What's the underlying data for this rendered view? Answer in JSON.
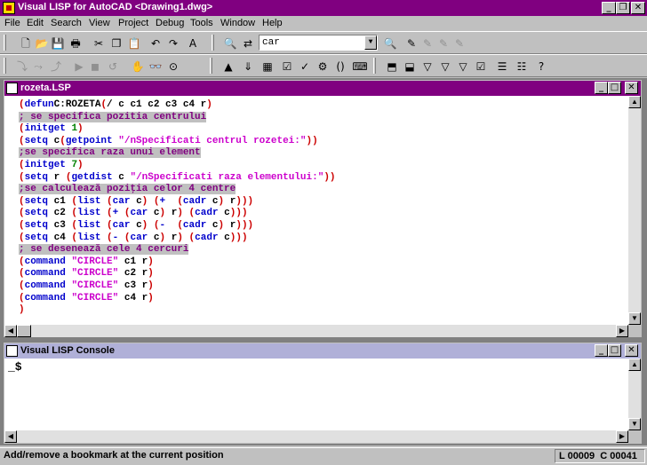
{
  "app": {
    "title": "Visual LISP for AutoCAD <Drawing1.dwg>"
  },
  "menu": [
    "File",
    "Edit",
    "Search",
    "View",
    "Project",
    "Debug",
    "Tools",
    "Window",
    "Help"
  ],
  "search": {
    "value": "car"
  },
  "editor": {
    "title": "rozeta.LSP",
    "lines": [
      [
        [
          "par",
          "("
        ],
        [
          "kw",
          "defun"
        ],
        [
          "",
          "C:ROZETA"
        ],
        [
          "par",
          "("
        ],
        [
          "",
          "/ c c1 c2 c3 c4 r"
        ],
        [
          "par",
          ")"
        ]
      ],
      [
        [
          "cmt",
          "; se specifica pozitia centrului"
        ]
      ],
      [
        [
          "par",
          "("
        ],
        [
          "kw",
          "initget"
        ],
        [
          "",
          " "
        ],
        [
          "num",
          "1"
        ],
        [
          "par",
          ")"
        ]
      ],
      [
        [
          "par",
          "("
        ],
        [
          "kw",
          "setq"
        ],
        [
          "",
          " c"
        ],
        [
          "par",
          "("
        ],
        [
          "kw",
          "getpoint"
        ],
        [
          "",
          " "
        ],
        [
          "str",
          "\"/nSpecificati centrul rozetei:\""
        ],
        [
          "par",
          "))"
        ]
      ],
      [
        [
          "cmt",
          ";se specifica raza unui element"
        ]
      ],
      [
        [
          "par",
          "("
        ],
        [
          "kw",
          "initget"
        ],
        [
          "",
          " "
        ],
        [
          "num",
          "7"
        ],
        [
          "par",
          ")"
        ]
      ],
      [
        [
          "par",
          "("
        ],
        [
          "kw",
          "setq"
        ],
        [
          "",
          " r "
        ],
        [
          "par",
          "("
        ],
        [
          "kw",
          "getdist"
        ],
        [
          "",
          " c "
        ],
        [
          "str",
          "\"/nSpecificati raza elementului:\""
        ],
        [
          "par",
          "))"
        ]
      ],
      [
        [
          "cmt",
          ";se calculează poziţia celor 4 centre"
        ]
      ],
      [
        [
          "par",
          "("
        ],
        [
          "kw",
          "setq"
        ],
        [
          "",
          " c1 "
        ],
        [
          "par",
          "("
        ],
        [
          "kw",
          "list"
        ],
        [
          "",
          " "
        ],
        [
          "par",
          "("
        ],
        [
          "kw",
          "car"
        ],
        [
          "",
          " c"
        ],
        [
          "par",
          ")"
        ],
        [
          "",
          " "
        ],
        [
          "par",
          "("
        ],
        [
          "kw",
          "+"
        ],
        [
          "",
          "  "
        ],
        [
          "par",
          "("
        ],
        [
          "kw",
          "cadr"
        ],
        [
          "",
          " c"
        ],
        [
          "par",
          ")"
        ],
        [
          "",
          " r"
        ],
        [
          "par",
          ")))"
        ]
      ],
      [
        [
          "par",
          "("
        ],
        [
          "kw",
          "setq"
        ],
        [
          "",
          " c2 "
        ],
        [
          "par",
          "("
        ],
        [
          "kw",
          "list"
        ],
        [
          "",
          " "
        ],
        [
          "par",
          "("
        ],
        [
          "kw",
          "+"
        ],
        [
          "",
          " "
        ],
        [
          "par",
          "("
        ],
        [
          "kw",
          "car"
        ],
        [
          "",
          " c"
        ],
        [
          "par",
          ")"
        ],
        [
          "",
          " r"
        ],
        [
          "par",
          ")"
        ],
        [
          "",
          " "
        ],
        [
          "par",
          "("
        ],
        [
          "kw",
          "cadr"
        ],
        [
          "",
          " c"
        ],
        [
          "par",
          ")))"
        ]
      ],
      [
        [
          "par",
          "("
        ],
        [
          "kw",
          "setq"
        ],
        [
          "",
          " c3 "
        ],
        [
          "par",
          "("
        ],
        [
          "kw",
          "list"
        ],
        [
          "",
          " "
        ],
        [
          "par",
          "("
        ],
        [
          "kw",
          "car"
        ],
        [
          "",
          " c"
        ],
        [
          "par",
          ")"
        ],
        [
          "",
          " "
        ],
        [
          "par",
          "("
        ],
        [
          "kw",
          "-"
        ],
        [
          "",
          "  "
        ],
        [
          "par",
          "("
        ],
        [
          "kw",
          "cadr"
        ],
        [
          "",
          " c"
        ],
        [
          "par",
          ")"
        ],
        [
          "",
          " r"
        ],
        [
          "par",
          ")))"
        ]
      ],
      [
        [
          "par",
          "("
        ],
        [
          "kw",
          "setq"
        ],
        [
          "",
          " c4 "
        ],
        [
          "par",
          "("
        ],
        [
          "kw",
          "list"
        ],
        [
          "",
          " "
        ],
        [
          "par",
          "("
        ],
        [
          "kw",
          "-"
        ],
        [
          "",
          " "
        ],
        [
          "par",
          "("
        ],
        [
          "kw",
          "car"
        ],
        [
          "",
          " c"
        ],
        [
          "par",
          ")"
        ],
        [
          "",
          " r"
        ],
        [
          "par",
          ")"
        ],
        [
          "",
          " "
        ],
        [
          "par",
          "("
        ],
        [
          "kw",
          "cadr"
        ],
        [
          "",
          " c"
        ],
        [
          "par",
          ")))"
        ]
      ],
      [
        [
          "cmt",
          "; se desenează cele 4 cercuri"
        ]
      ],
      [
        [
          "par",
          "("
        ],
        [
          "kw",
          "command"
        ],
        [
          "",
          " "
        ],
        [
          "str",
          "\"CIRCLE\""
        ],
        [
          "",
          " c1 r"
        ],
        [
          "par",
          ")"
        ]
      ],
      [
        [
          "par",
          "("
        ],
        [
          "kw",
          "command"
        ],
        [
          "",
          " "
        ],
        [
          "str",
          "\"CIRCLE\""
        ],
        [
          "",
          " c2 r"
        ],
        [
          "par",
          ")"
        ]
      ],
      [
        [
          "par",
          "("
        ],
        [
          "kw",
          "command"
        ],
        [
          "",
          " "
        ],
        [
          "str",
          "\"CIRCLE\""
        ],
        [
          "",
          " c3 r"
        ],
        [
          "par",
          ")"
        ]
      ],
      [
        [
          "par",
          "("
        ],
        [
          "kw",
          "command"
        ],
        [
          "",
          " "
        ],
        [
          "str",
          "\"CIRCLE\""
        ],
        [
          "",
          " c4 r"
        ],
        [
          "par",
          ")"
        ]
      ],
      [
        [
          "par",
          ")"
        ]
      ]
    ]
  },
  "console": {
    "title": "Visual LISP Console",
    "prompt": "_$"
  },
  "status": {
    "message": "Add/remove a bookmark at the current position",
    "position": "L 00009  C 00041"
  }
}
